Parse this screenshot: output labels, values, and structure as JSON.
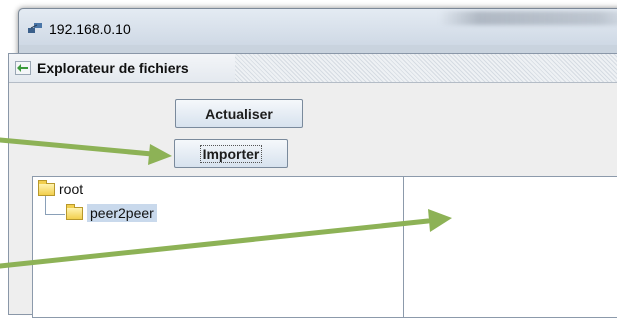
{
  "window": {
    "title": "192.168.0.10",
    "icon": "network-computer-icon"
  },
  "file_explorer": {
    "title": "Explorateur de fichiers",
    "icon": "back-arrow-icon",
    "buttons": {
      "refresh_label": "Actualiser",
      "import_label": "Importer"
    },
    "tree": {
      "root_label": "root",
      "child_label": "peer2peer"
    }
  },
  "annotations": {
    "arrow_color": "#8db256",
    "arrows": [
      "arrow-to-import-button",
      "arrow-to-file-panel"
    ]
  }
}
